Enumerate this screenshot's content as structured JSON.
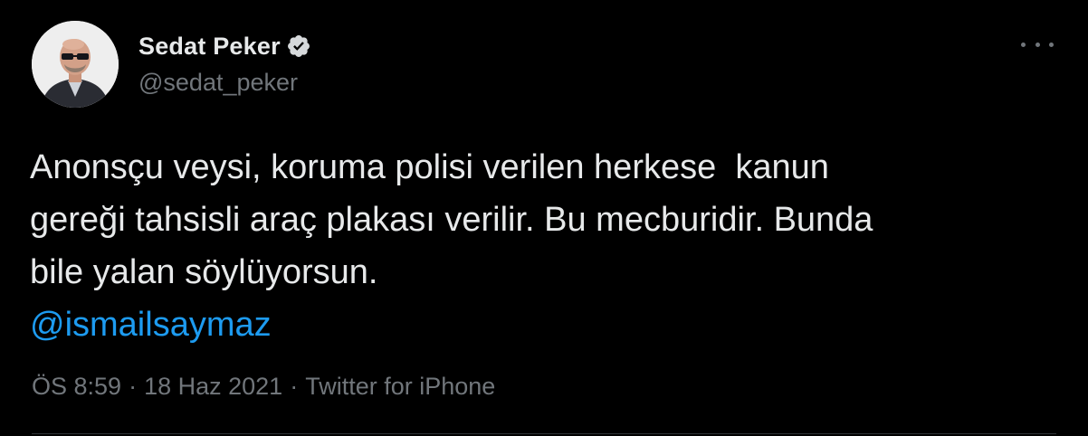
{
  "tweet": {
    "display_name": "Sedat Peker",
    "handle": "@sedat_peker",
    "verified": true,
    "text_lines": [
      "Anonsçu veysi, koruma polisi verilen herkese  kanun",
      "gereği tahsisli araç plakası verilir. Bu mecburidir. Bunda",
      "bile yalan söylüyorsun."
    ],
    "mention": "@ismailsaymaz",
    "time": "ÖS 8:59",
    "separator": "·",
    "date": "18 Haz 2021",
    "source": "Twitter for iPhone"
  },
  "icons": {
    "verified": "verified-badge-icon",
    "more": "more-options-icon"
  },
  "colors": {
    "background": "#000000",
    "text": "#e7e9ea",
    "secondary": "#71767b",
    "link": "#1d9bf0"
  }
}
